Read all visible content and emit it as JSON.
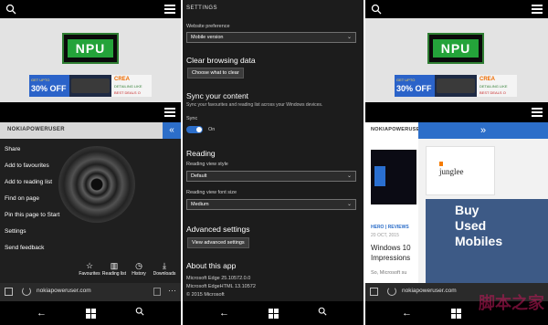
{
  "left": {
    "site_name": "NOKIAPOWERUSER",
    "npu_logo": "NPU",
    "ad": {
      "left_line1": "GET UPTO",
      "left_line2": "30% OFF",
      "right_line1": "CREA",
      "right_line2": "DETAILING LIKE",
      "right_line3": "BEST DEALS O"
    },
    "chevron": "«",
    "menu": [
      "Share",
      "Add to favourites",
      "Add to reading list",
      "Find on page",
      "Pin this page to Start",
      "Settings",
      "Send feedback"
    ],
    "toolbar": [
      {
        "icon": "star-icon",
        "glyph": "☆",
        "label": "Favourites"
      },
      {
        "icon": "reading-list-icon",
        "glyph": "▥",
        "label": "Reading list"
      },
      {
        "icon": "history-icon",
        "glyph": "◷",
        "label": "History"
      },
      {
        "icon": "download-icon",
        "glyph": "⤓",
        "label": "Downloads"
      }
    ],
    "url": "nokiapoweruser.com",
    "more": "···"
  },
  "settings": {
    "header": "SETTINGS",
    "website_preference_label": "Website preference",
    "website_preference_value": "Mobile version",
    "clear_heading": "Clear browsing data",
    "clear_button": "Choose what to clear",
    "sync_heading": "Sync your content",
    "sync_desc": "Sync your favourites and reading list across your Windows devices.",
    "sync_label": "Sync",
    "sync_state": "On",
    "reading_heading": "Reading",
    "reading_style_label": "Reading view style",
    "reading_style_value": "Default",
    "reading_font_label": "Reading view font size",
    "reading_font_value": "Medium",
    "advanced_heading": "Advanced settings",
    "advanced_button": "View advanced settings",
    "about_heading": "About this app",
    "about_lines": [
      "Microsoft Edge 25.10572.0.0",
      "Microsoft EdgeHTML 13.10572",
      "© 2015 Microsoft"
    ]
  },
  "right": {
    "site_name": "NOKIAPOWERUSE",
    "chevron": "»",
    "jg_logo": "junglee",
    "side_ad": [
      "Buy",
      "Used",
      "Mobiles"
    ],
    "article_section": "HERO | REVIEWS",
    "article_date": "20 OCT, 2015",
    "article_title": [
      "Windows 10",
      "Impressions"
    ],
    "article_by": "So, Microsoft su",
    "watermark": "脚本之家"
  },
  "colors": {
    "accent": "#2c6ec9",
    "npu_green": "#24a33a"
  }
}
